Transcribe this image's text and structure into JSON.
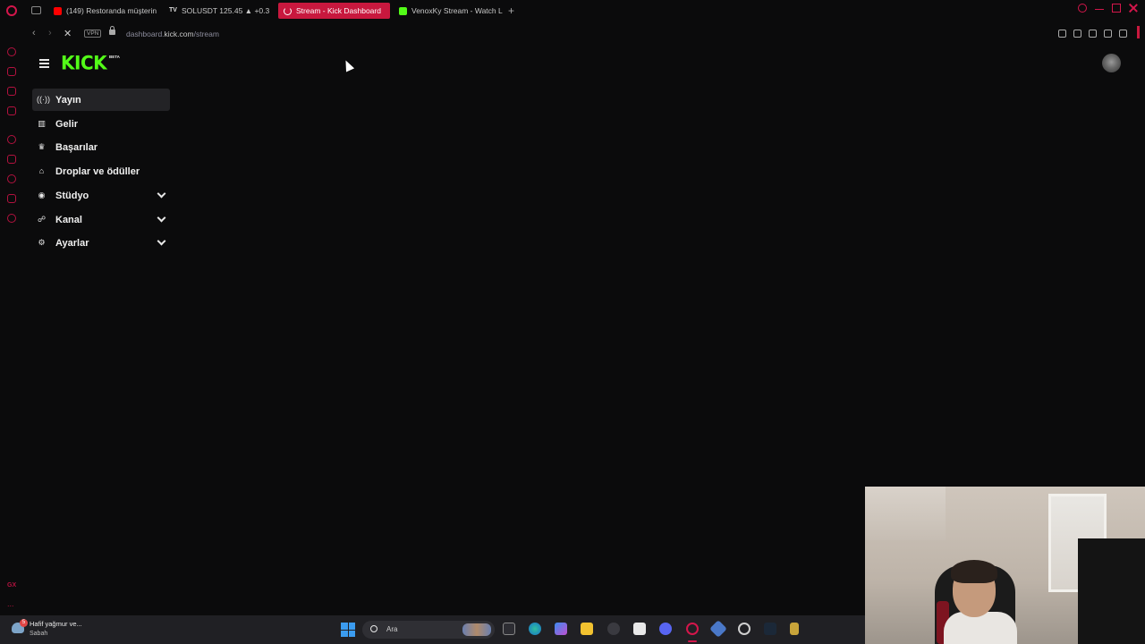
{
  "browser": {
    "tabs": [
      {
        "title": "(149) Restoranda müşterin",
        "favicon": "youtube-icon"
      },
      {
        "title": "SOLUSDT 125.45 ▲ +0.3",
        "favicon": "tradingview-icon",
        "favicon_text": "TV"
      },
      {
        "title": "Stream - Kick Dashboard",
        "favicon": "loading-spinner-icon",
        "active": true
      },
      {
        "title": "VenoxKy Stream - Watch L",
        "favicon": "kick-icon"
      }
    ],
    "new_tab_label": "+",
    "address": {
      "vpn_label": "VPN",
      "url_prefix": "dashboard.",
      "url_domain": "kick.com",
      "url_path": "/stream"
    },
    "accent_color": "#c8183e"
  },
  "kick": {
    "logo_text": "KICK",
    "beta_label": "BETA",
    "brand_color": "#53fc18",
    "menu": [
      {
        "label": "Yayın",
        "icon": "broadcast-icon",
        "active": true,
        "expandable": false
      },
      {
        "label": "Gelir",
        "icon": "chart-icon",
        "active": false,
        "expandable": false
      },
      {
        "label": "Başarılar",
        "icon": "trophy-icon",
        "active": false,
        "expandable": false
      },
      {
        "label": "Droplar ve ödüller",
        "icon": "gift-icon",
        "active": false,
        "expandable": false
      },
      {
        "label": "Stüdyo",
        "icon": "camera-icon",
        "active": false,
        "expandable": true
      },
      {
        "label": "Kanal",
        "icon": "users-icon",
        "active": false,
        "expandable": true
      },
      {
        "label": "Ayarlar",
        "icon": "gear-icon",
        "active": false,
        "expandable": true
      }
    ]
  },
  "sidebar_gx": {
    "label": "GX",
    "more": "..."
  },
  "taskbar": {
    "weather_title": "Hafif yağmur ve...",
    "weather_subtitle": "Sabah",
    "weather_badge": "5",
    "search_placeholder": "Ara"
  }
}
